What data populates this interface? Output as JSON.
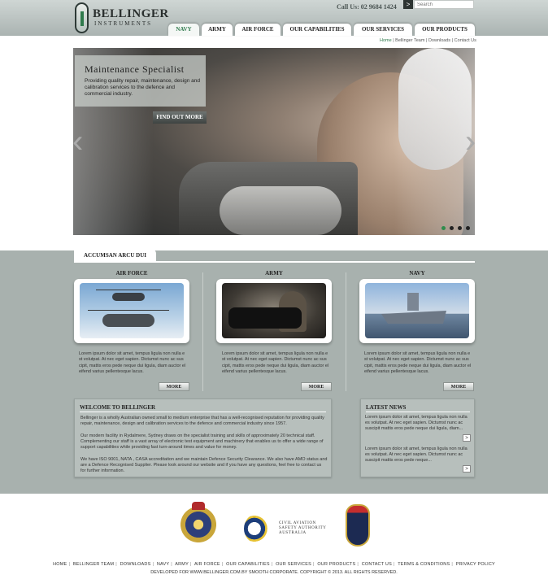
{
  "header": {
    "logo_name": "BELLINGER",
    "logo_sub": "INSTRUMENTS",
    "callus": "Call Us: 02 9684 1424",
    "search_placeholder": "Search",
    "search_go": ">"
  },
  "nav": [
    "NAVY",
    "ARMY",
    "AIR FORCE",
    "OUR CAPABILITIES",
    "OUR SERVICES",
    "OUR PRODUCTS"
  ],
  "utility": {
    "home": "Home",
    "team": "Bellinger Team",
    "downloads": "Downloads",
    "contact": "Contact Us",
    "sep": "|"
  },
  "hero": {
    "title": "Maintenance Specialist",
    "text": "Providing quality repair, maintenance, design and calibration services to the defence and commercial industry.",
    "button": "FIND OUT MORE",
    "arrow_left": "‹",
    "arrow_right": "›",
    "slide_count": 4,
    "active_slide": 1
  },
  "band": {
    "tab": "ACCUMSAN ARCU DUI",
    "columns": [
      {
        "title": "AIR FORCE",
        "text": "Lorem ipsum dolor sit amet, tempus ligula non nulla e st volutpat. At nec eget sapien. Dictumst nunc ac sus cipit, mattis eros pede neque dui ligula, diam auctor el eifend varius pellentesque lacus.",
        "more": "MORE"
      },
      {
        "title": "ARMY",
        "text": "Lorem ipsum dolor sit amet, tempus ligula non nulla e st volutpat. At nec eget sapien. Dictumst nunc ac sus cipit, mattis eros pede neque dui ligula, diam auctor el eifend varius pellentesque lacus.",
        "more": "MORE"
      },
      {
        "title": "NAVY",
        "text": "Lorem ipsum dolor sit amet, tempus ligula non nulla e st volutpat. At nec eget sapien. Dictumst nunc ac sus cipit, mattis eros pede neque dui ligula, diam auctor el eifend varius pellentesque lacus.",
        "more": "MORE"
      }
    ]
  },
  "welcome": {
    "title": "WELCOME TO BELLINGER",
    "p1": "Bellinger is a wholly Australian owned small to medium enterprise that has a well-recognised reputation for providing quality repair, maintenance, design and calibration services to the defence and commercial industry since 1957.",
    "p2": "Our modern facility in Rydalmere, Sydney draws on the specialist training and skills of approximately 20 technical staff. Complementing our staff is a vast array of electronic test equipment and machinery that enables us to offer a wide range of support capabilities while providing fast turn-around times and value for money.",
    "p3": "We have ISO 9001, NATA , CASA accreditation and we maintain Defence Security Clearance. We also have AMO status and are a Defence Recognised Supplier. Please look around our website and if you have any questions, feel free to contact us for further information."
  },
  "news": {
    "title": "LATEST NEWS",
    "items": [
      "Lorem ipsum dolor sit amet, tempus ligula non nulla es volutpat. At nec eget sapien. Dictumst nunc ac suscipit mattis eros pede neque dui ligula, diam...",
      "Lorem ipsum dolor sit amet, tempus ligula non nulla es volutpat. At nec eget sapien. Dictumst nunc ac suscipit mattis eros pede neque..."
    ],
    "go": ">"
  },
  "footer": {
    "casa_line1": "CIVIL AVIATION",
    "casa_line2": "SAFETY AUTHORITY",
    "casa_line3": "AUSTRALIA",
    "links": [
      "HOME",
      "BELLINGER TEAM",
      "DOWNLOADS",
      "NAVY",
      "ARMY",
      "AIR FORCE",
      "OUR CAPABILITIES",
      "OUR SERVICES",
      "OUR PRODUCTS",
      "CONTACT US",
      "TERMS & CONDITIONS",
      "PRIVACY POLICY"
    ],
    "sep": "|",
    "copyright": "DEVELOPED FOR WWW.BELLINGER.COM.BY SMOOTH CORPORATE. COPYRIGHT © 2013.  ALL RIGHTS RESERVED."
  },
  "colors": {
    "accent": "#2f7a4c",
    "band": "#a8b1ae",
    "header": "#b5bdbb"
  }
}
